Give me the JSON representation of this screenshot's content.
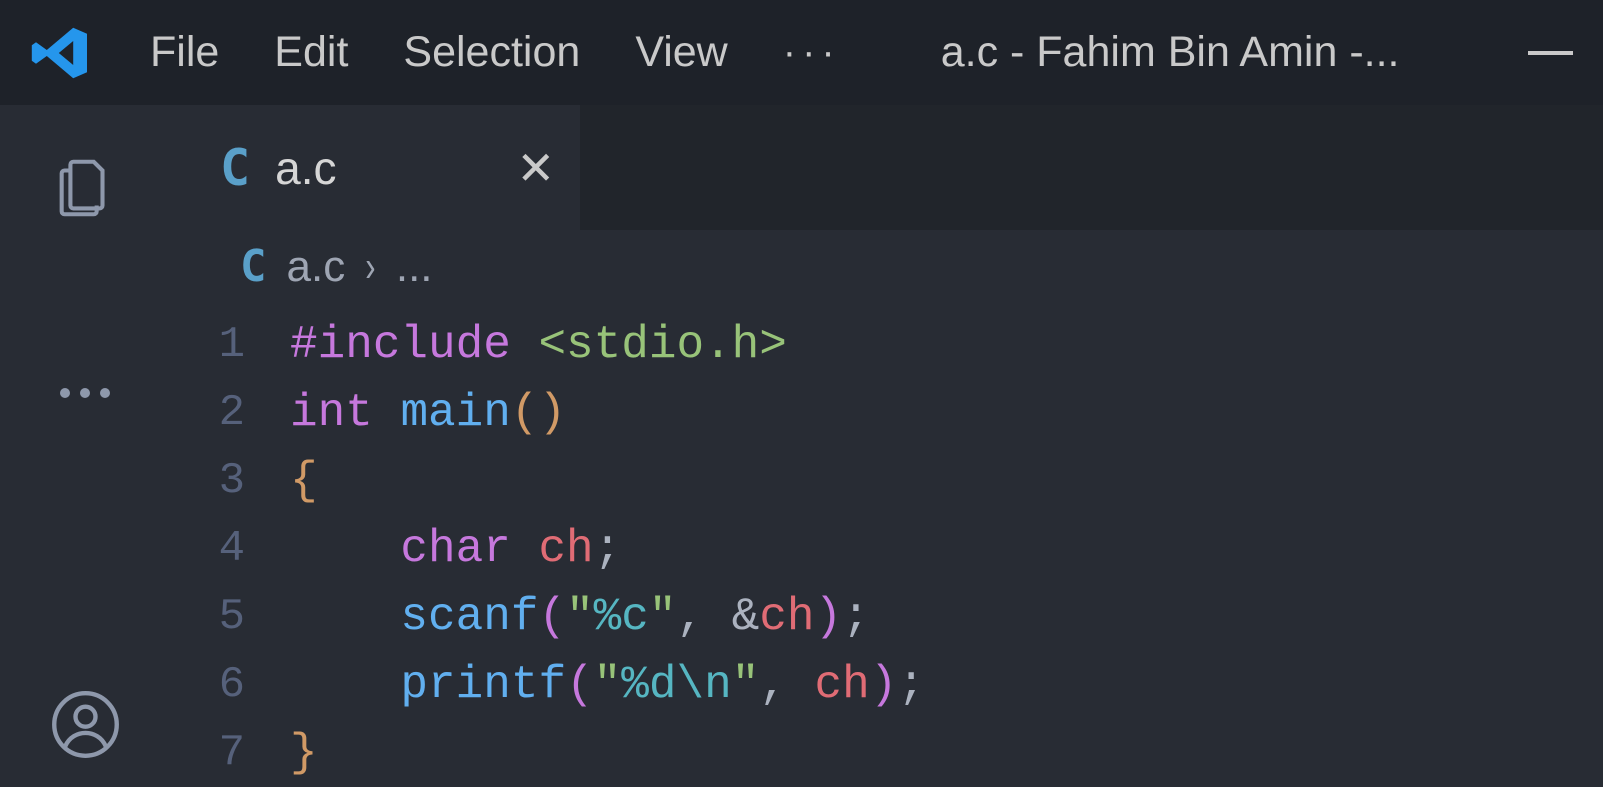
{
  "menu": {
    "file": "File",
    "edit": "Edit",
    "selection": "Selection",
    "view": "View",
    "more": "···"
  },
  "title": "a.c - Fahim Bin Amin -...",
  "tab": {
    "label": "a.c"
  },
  "breadcrumb": {
    "file": "a.c",
    "sep": "›",
    "tail": "..."
  },
  "code": {
    "lines": [
      "1",
      "2",
      "3",
      "4",
      "5",
      "6",
      "7"
    ],
    "l1": {
      "include": "#include",
      "hdr": "<stdio.h>"
    },
    "l2": {
      "int": "int",
      "main": "main",
      "open": "(",
      "close": ")"
    },
    "l3": {
      "brace": "{"
    },
    "l4": {
      "char": "char",
      "ch": "ch",
      "semi": ";"
    },
    "l5": {
      "scanf": "scanf",
      "open": "(",
      "q1": "\"",
      "esc": "%c",
      "q2": "\"",
      "comma": ", ",
      "amp": "&",
      "ch": "ch",
      "close": ")",
      "semi": ";"
    },
    "l6": {
      "printf": "printf",
      "open": "(",
      "q1": "\"",
      "esc1": "%d",
      "esc2": "\\n",
      "q2": "\"",
      "comma": ", ",
      "ch": "ch",
      "close": ")",
      "semi": ";"
    },
    "l7": {
      "brace": "}"
    }
  }
}
